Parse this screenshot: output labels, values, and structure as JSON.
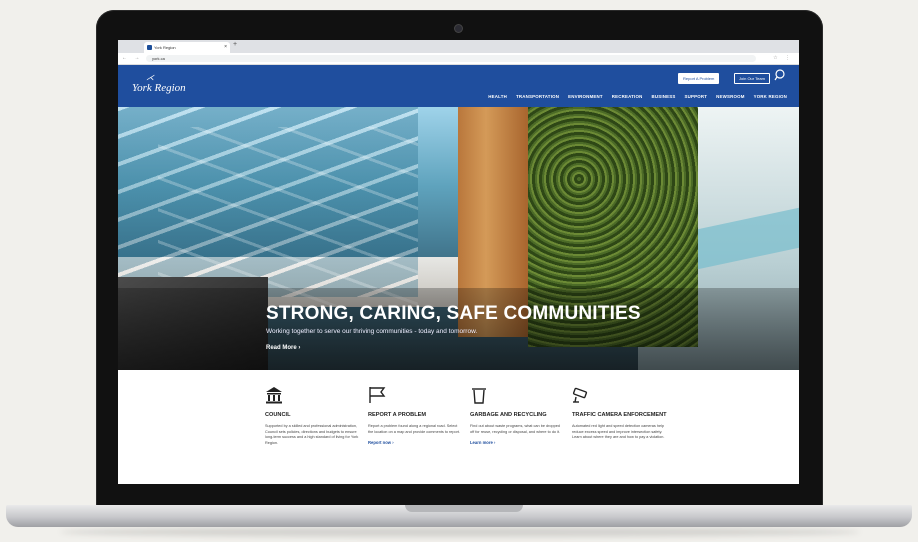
{
  "browser": {
    "tab_title": "York Region",
    "tab_close": "×",
    "new_tab": "+",
    "nav_buttons": "← → ⟳",
    "url": "york.ca",
    "addr_icons": "☆ ⋮"
  },
  "header": {
    "logo_text": "York Region",
    "logo_mark": "⋌",
    "report_button": "Report A Problem",
    "join_button": "Join Our Team",
    "search_icon": "search-icon",
    "menu": [
      "HEALTH",
      "TRANSPORTATION",
      "ENVIRONMENT",
      "RECREATION",
      "BUSINESS",
      "SUPPORT",
      "NEWSROOM",
      "YORK REGION"
    ],
    "brand_color": "#1f4e9e"
  },
  "hero": {
    "title": "STRONG, CARING, SAFE COMMUNITIES",
    "subtitle": "Working together to serve our thriving communities - today and tomorrow.",
    "read_more": "Read More  ›"
  },
  "cards": [
    {
      "icon": "building-icon",
      "title": "COUNCIL",
      "text": "Supported by a skilled and professional administration, Council sets policies, directions and budgets to ensure long-term success and a high standard of living for York Region.",
      "link": ""
    },
    {
      "icon": "flag-icon",
      "title": "REPORT A PROBLEM",
      "text": "Report a problem found along a regional road. Select the location on a map and provide comments to report.",
      "link": "Report now  ›"
    },
    {
      "icon": "trash-icon",
      "title": "GARBAGE AND RECYCLING",
      "text": "Find out about waste programs, what can be dropped off for reuse, recycling or disposal, and where to do it.",
      "link": "Learn more  ›"
    },
    {
      "icon": "camera-icon",
      "title": "TRAFFIC CAMERA ENFORCEMENT",
      "text": "Automated red light and speed detection cameras help reduce excess speed and improve intersection safety. Learn about where they are and how to pay a violation.",
      "link": ""
    }
  ]
}
